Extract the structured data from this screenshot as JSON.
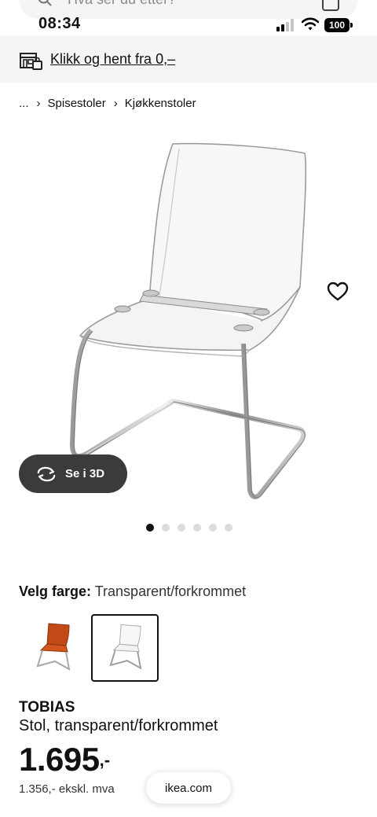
{
  "search": {
    "placeholder": "Hva ser du etter?"
  },
  "status_bar": {
    "time": "08:34",
    "battery": "100"
  },
  "pickup": {
    "label": "Klikk og hent fra 0,–"
  },
  "breadcrumb": {
    "ellipsis": "...",
    "items": [
      "Spisestoler",
      "Kjøkkenstoler"
    ]
  },
  "media": {
    "view3d_label": "Se i 3D",
    "dot_count": 6,
    "active_dot": 0
  },
  "color": {
    "label": "Velg farge:",
    "value": "Transparent/forkrommet",
    "options_selected": 1
  },
  "product": {
    "name": "TOBIAS",
    "description": "Stol, transparent/forkrommet",
    "price_main": "1.695",
    "price_suffix": ",-",
    "price_ex_vat": "1.356,- ekskl. mva"
  },
  "browser": {
    "url": "ikea.com"
  },
  "colors": {
    "accent": "#111111",
    "bar_bg": "#f5f5f5",
    "button_dark": "#3b3b3b",
    "orange_chair": "#c24a17"
  }
}
